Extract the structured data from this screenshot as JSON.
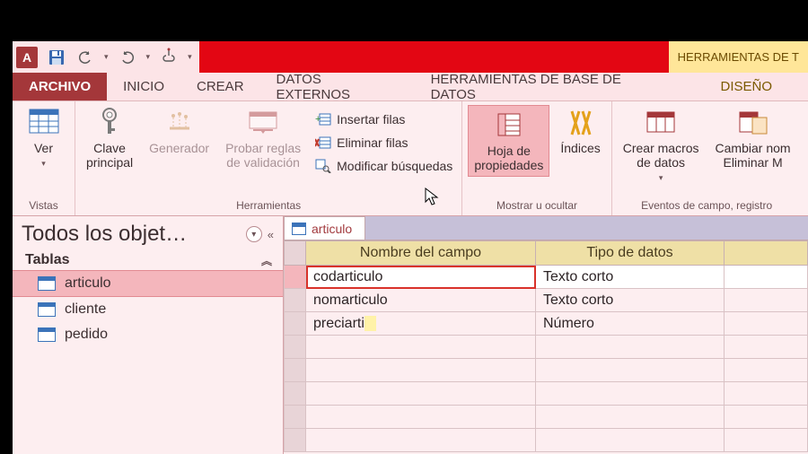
{
  "titlebar": {
    "contextual_label": "HERRAMIENTAS DE T"
  },
  "tabs": {
    "file": "ARCHIVO",
    "home": "INICIO",
    "create": "CREAR",
    "external": "DATOS EXTERNOS",
    "dbtools": "HERRAMIENTAS DE BASE DE DATOS",
    "design": "DISEÑO"
  },
  "ribbon": {
    "ver": "Ver",
    "vistas_group": "Vistas",
    "clave": "Clave\nprincipal",
    "generador": "Generador",
    "probar": "Probar reglas\nde validación",
    "insertar": "Insertar filas",
    "eliminar": "Eliminar filas",
    "modificar": "Modificar búsquedas",
    "herramientas_group": "Herramientas",
    "hoja": "Hoja de\npropiedades",
    "indices": "Índices",
    "mostrar_group": "Mostrar u ocultar",
    "macros": "Crear macros\nde datos",
    "cambiar": "Cambiar nom\nEliminar M",
    "eventos_group": "Eventos de campo, registro"
  },
  "nav": {
    "title": "Todos los objet…",
    "section": "Tablas",
    "items": [
      "articulo",
      "cliente",
      "pedido"
    ]
  },
  "doc": {
    "tab": "articulo",
    "col_name": "Nombre del campo",
    "col_type": "Tipo de datos",
    "rows": [
      {
        "name": "codarticulo",
        "type": "Texto corto"
      },
      {
        "name": "nomarticulo",
        "type": "Texto corto"
      },
      {
        "name": "preciarti",
        "type": "Número"
      }
    ]
  }
}
